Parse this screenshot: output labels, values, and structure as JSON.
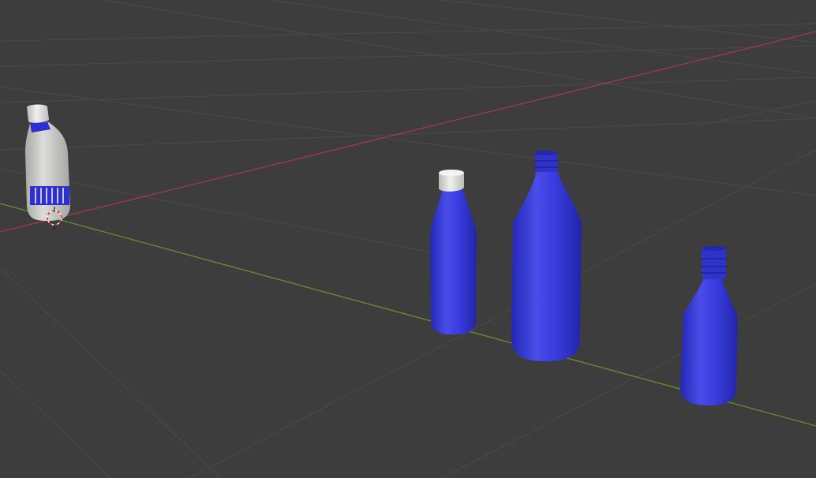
{
  "app": "3D viewport",
  "viewport": {
    "background": "#3d3d3d",
    "grid_color": "#4d4d4d",
    "x_axis_color": "#a03c44",
    "y_axis_color": "#6a8f2a"
  },
  "scene": {
    "objects": [
      {
        "name": "labeled-bottle",
        "body_color": "#c8c8c6",
        "label_color": "#2d2fd0",
        "cap_color": "#e8e8e4"
      },
      {
        "name": "small-blue-bottle",
        "body_color": "#3336d6",
        "cap_color": "#e0e0da"
      },
      {
        "name": "large-blue-bottle",
        "body_color": "#3336d6"
      },
      {
        "name": "short-blue-bottle",
        "body_color": "#3336d6"
      }
    ],
    "cursor": {
      "name": "3d-cursor",
      "colors": [
        "#ffffff",
        "#d23030"
      ]
    }
  }
}
